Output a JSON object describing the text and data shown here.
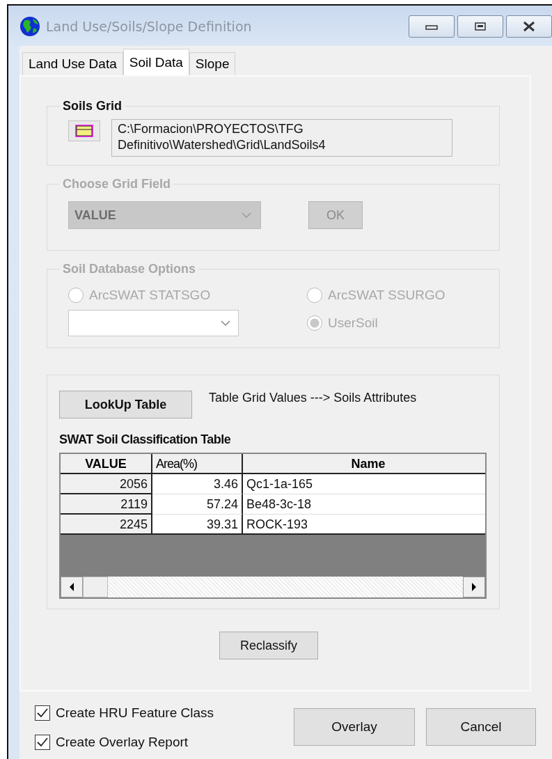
{
  "window": {
    "title": "Land Use/Soils/Slope Definition"
  },
  "tabs": [
    {
      "label": "Land Use Data",
      "selected": false
    },
    {
      "label": "Soil Data",
      "selected": true
    },
    {
      "label": "Slope",
      "selected": false
    }
  ],
  "soils_grid": {
    "title": "Soils Grid",
    "path": "C:\\Formacion\\PROYECTOS\\TFG Definitivo\\Watershed\\Grid\\LandSoils4"
  },
  "grid_field": {
    "title": "Choose Grid Field",
    "disabled": true,
    "field": "VALUE",
    "ok_button": "OK"
  },
  "soil_database": {
    "title": "Soil Database Options",
    "disabled": true,
    "options": [
      {
        "label": "ArcSWAT STATSGO",
        "selected": false
      },
      {
        "label": "ArcSWAT SSURGO",
        "selected": false
      },
      {
        "label": "UserSoil",
        "selected": true
      }
    ]
  },
  "lookup": {
    "button": "LookUp Table",
    "note": "Table Grid Values ---> Soils Attributes"
  },
  "table": {
    "title": "SWAT Soil Classification Table",
    "columns": [
      {
        "label": "VALUE",
        "bold": true
      },
      {
        "label": "Area(%)",
        "bold": false
      },
      {
        "label": "Name",
        "bold": true
      }
    ],
    "rows": [
      [
        "2056",
        "3.46",
        "Qc1-1a-165"
      ],
      [
        "2119",
        "57.24",
        "Be48-3c-18"
      ],
      [
        "2245",
        "39.31",
        "ROCK-193"
      ]
    ]
  },
  "reclassify_button": "Reclassify",
  "options": [
    {
      "label": "Create HRU Feature Class",
      "checked": true
    },
    {
      "label": "Create Overlay Report",
      "checked": true
    }
  ],
  "buttons": [
    "Overlay",
    "Cancel"
  ]
}
